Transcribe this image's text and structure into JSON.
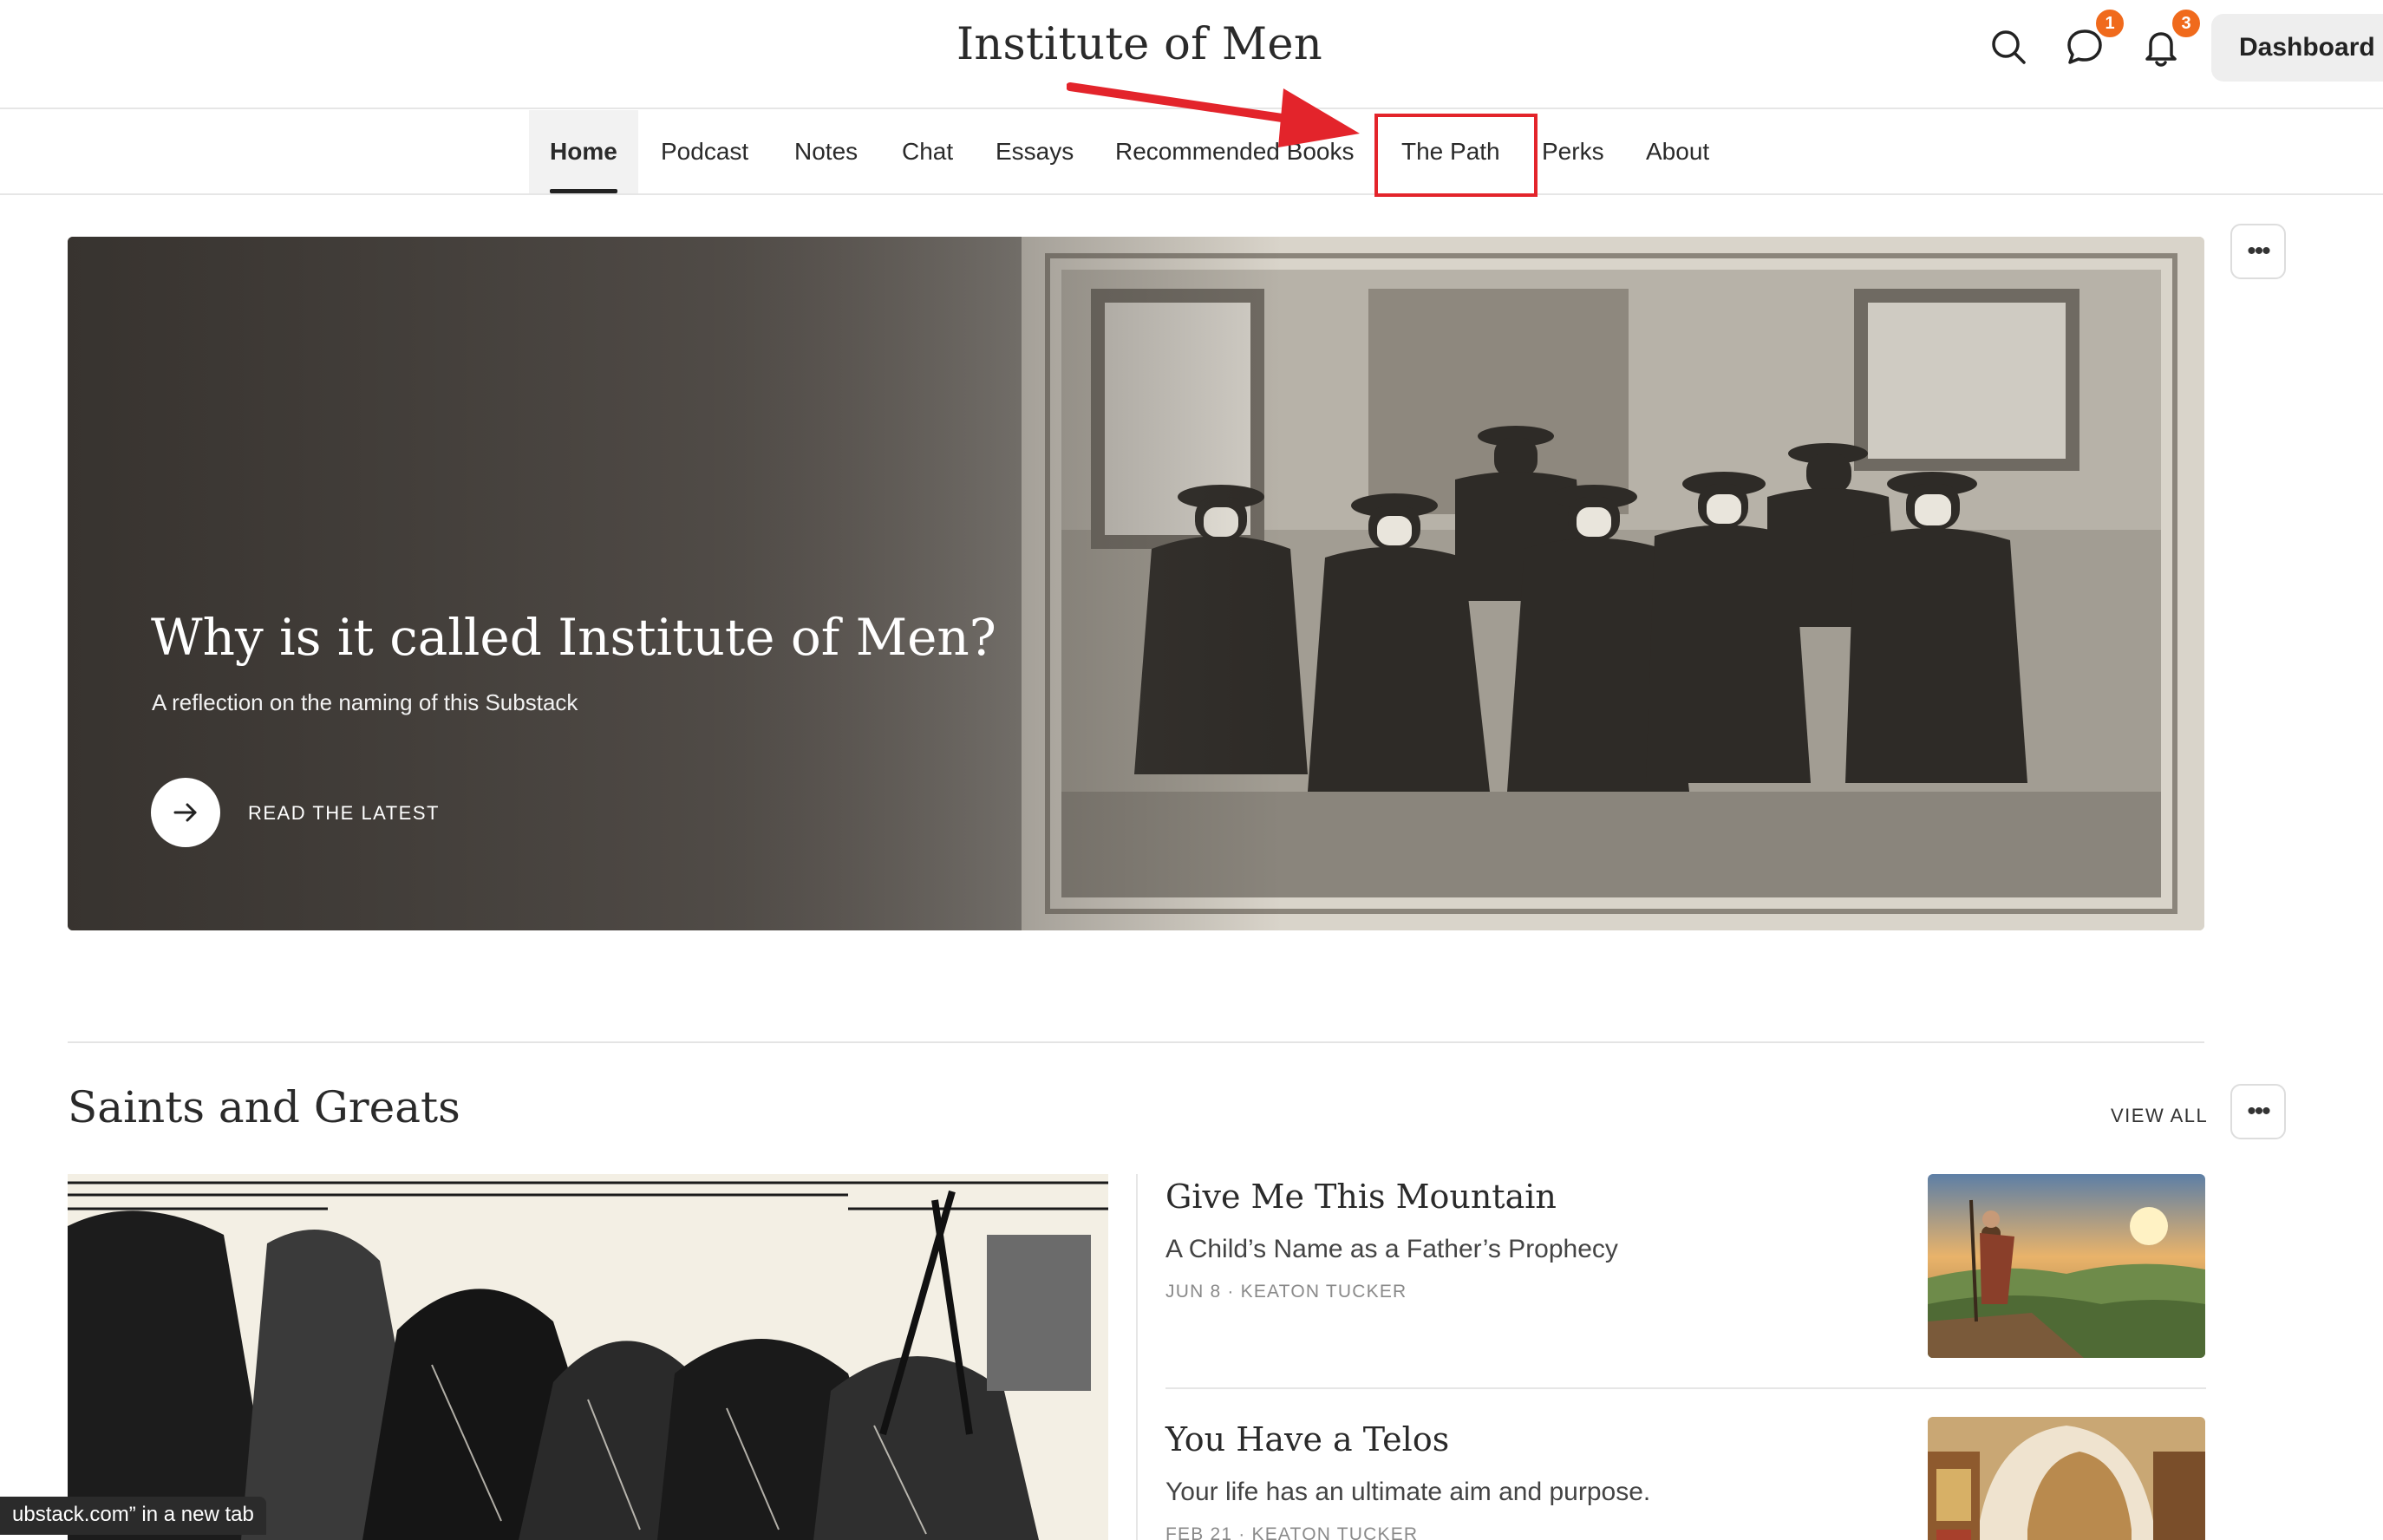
{
  "header": {
    "site_title": "Institute of Men",
    "chat_badge": "1",
    "notifications_badge": "3",
    "dashboard_label": "Dashboard"
  },
  "nav": {
    "items": [
      "Home",
      "Podcast",
      "Notes",
      "Chat",
      "Essays",
      "Recommended Books",
      "The Path",
      "Perks",
      "About"
    ],
    "active": "Home",
    "highlighted": "The Path"
  },
  "hero": {
    "title": "Why is it called Institute of Men?",
    "subtitle": "A reflection on the naming of this Substack",
    "cta_label": "READ THE LATEST"
  },
  "section": {
    "title": "Saints and Greats",
    "view_all": "VIEW ALL"
  },
  "posts": [
    {
      "title": "Give Me This Mountain",
      "subtitle": "A Child’s Name as a Father’s Prophecy",
      "meta": "JUN 8 · KEATON TUCKER"
    },
    {
      "title": "You Have a Telos",
      "subtitle": "Your life has an ultimate aim and purpose.",
      "meta": "FEB 21 · KEATON TUCKER"
    }
  ],
  "status_bar": {
    "text": "ubstack.com” in a new tab"
  },
  "colors": {
    "badge": "#f06a1c",
    "annotation": "#e3242b"
  },
  "icons": [
    "search-icon",
    "chat-icon",
    "bell-icon",
    "arrow-right-icon",
    "more-icon"
  ]
}
